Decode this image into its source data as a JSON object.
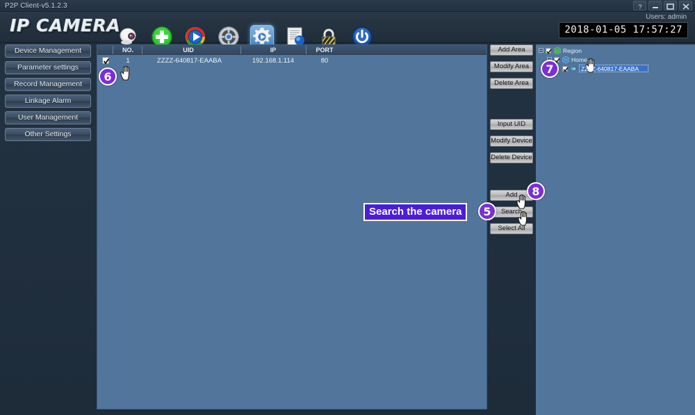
{
  "window": {
    "title": "P2P Client-v5.1.2.3",
    "controls": [
      {
        "name": "help-button",
        "glyph": "?"
      },
      {
        "name": "minimize-button",
        "glyph": "–"
      },
      {
        "name": "maximize-button",
        "glyph": "❐"
      },
      {
        "name": "close-button",
        "glyph": "✕"
      }
    ]
  },
  "header": {
    "brand": "IP CAMERA",
    "user_label": "Users: admin",
    "datetime": "2018-01-05  17:57:27",
    "toolbar": [
      {
        "name": "camera-icon",
        "label": "Camera",
        "selected": false
      },
      {
        "name": "add-device-icon",
        "label": "Add",
        "selected": false
      },
      {
        "name": "play-icon",
        "label": "Playback",
        "selected": false
      },
      {
        "name": "ptz-wheel-icon",
        "label": "PTZ",
        "selected": false
      },
      {
        "name": "settings-gear-icon",
        "label": "Settings",
        "selected": true
      },
      {
        "name": "log-document-icon",
        "label": "Log",
        "selected": false
      },
      {
        "name": "lock-icon",
        "label": "Lock",
        "selected": false
      },
      {
        "name": "power-icon",
        "label": "Exit",
        "selected": false
      }
    ]
  },
  "sidebar": {
    "items": [
      {
        "label": "Device Management",
        "name": "sidebar-item-device-management"
      },
      {
        "label": "Parameter settings",
        "name": "sidebar-item-parameter-settings"
      },
      {
        "label": "Record Management",
        "name": "sidebar-item-record-management"
      },
      {
        "label": "Linkage Alarm",
        "name": "sidebar-item-linkage-alarm"
      },
      {
        "label": "User Management",
        "name": "sidebar-item-user-management"
      },
      {
        "label": "Other Settings",
        "name": "sidebar-item-other-settings"
      }
    ]
  },
  "device_list": {
    "columns": [
      "NO.",
      "UID",
      "IP",
      "PORT"
    ],
    "rows": [
      {
        "checked": true,
        "no": "1",
        "uid": "ZZZZ-640817-EAABA",
        "ip": "192.168.1.114",
        "port": "80"
      }
    ]
  },
  "buttons": {
    "area": [
      {
        "label": "Add Area",
        "name": "add-area-button"
      },
      {
        "label": "Modify Area",
        "name": "modify-area-button"
      },
      {
        "label": "Delete Area",
        "name": "delete-area-button"
      }
    ],
    "device": [
      {
        "label": "Input UID",
        "name": "input-uid-button"
      },
      {
        "label": "Modify Device",
        "name": "modify-device-button"
      },
      {
        "label": "Delete Device",
        "name": "delete-device-button"
      }
    ],
    "actions": [
      {
        "label": "Add",
        "name": "add-button"
      },
      {
        "label": "Search",
        "name": "search-button"
      },
      {
        "label": "Select All",
        "name": "select-all-button"
      }
    ]
  },
  "tree": {
    "nodes": [
      {
        "label": "Region",
        "name": "tree-node-region",
        "checked": true,
        "expanded": true,
        "depth": 0,
        "icon": "globe-green-icon",
        "selected": false
      },
      {
        "label": "Home",
        "name": "tree-node-home",
        "checked": true,
        "expanded": true,
        "depth": 1,
        "icon": "globe-blue-icon",
        "selected": false
      },
      {
        "label": "ZZZZ-640817-EAABA",
        "name": "tree-node-device",
        "checked": true,
        "expanded": false,
        "depth": 2,
        "icon": "device-icon",
        "selected": true
      }
    ]
  },
  "annotations": {
    "search_label": "Search the camera",
    "badges": [
      {
        "text": "5",
        "name": "callout-badge-5"
      },
      {
        "text": "6",
        "name": "callout-badge-6"
      },
      {
        "text": "7",
        "name": "callout-badge-7"
      },
      {
        "text": "8",
        "name": "callout-badge-8"
      }
    ]
  },
  "colors": {
    "panel_blue": "#52759b",
    "chrome_dark": "#223040",
    "accent_purple": "#7b2fd6",
    "annot_blue": "#4a1ed8",
    "selection_blue": "#3b71c4"
  }
}
